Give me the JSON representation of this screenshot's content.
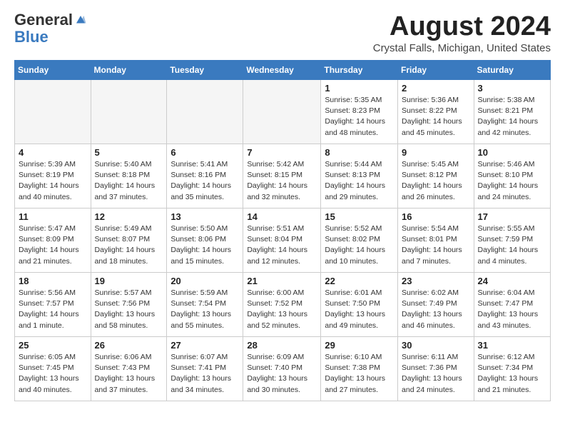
{
  "logo": {
    "general": "General",
    "blue": "Blue"
  },
  "header": {
    "month": "August 2024",
    "location": "Crystal Falls, Michigan, United States"
  },
  "days_of_week": [
    "Sunday",
    "Monday",
    "Tuesday",
    "Wednesday",
    "Thursday",
    "Friday",
    "Saturday"
  ],
  "weeks": [
    [
      {
        "day": "",
        "info": ""
      },
      {
        "day": "",
        "info": ""
      },
      {
        "day": "",
        "info": ""
      },
      {
        "day": "",
        "info": ""
      },
      {
        "day": "1",
        "info": "Sunrise: 5:35 AM\nSunset: 8:23 PM\nDaylight: 14 hours\nand 48 minutes."
      },
      {
        "day": "2",
        "info": "Sunrise: 5:36 AM\nSunset: 8:22 PM\nDaylight: 14 hours\nand 45 minutes."
      },
      {
        "day": "3",
        "info": "Sunrise: 5:38 AM\nSunset: 8:21 PM\nDaylight: 14 hours\nand 42 minutes."
      }
    ],
    [
      {
        "day": "4",
        "info": "Sunrise: 5:39 AM\nSunset: 8:19 PM\nDaylight: 14 hours\nand 40 minutes."
      },
      {
        "day": "5",
        "info": "Sunrise: 5:40 AM\nSunset: 8:18 PM\nDaylight: 14 hours\nand 37 minutes."
      },
      {
        "day": "6",
        "info": "Sunrise: 5:41 AM\nSunset: 8:16 PM\nDaylight: 14 hours\nand 35 minutes."
      },
      {
        "day": "7",
        "info": "Sunrise: 5:42 AM\nSunset: 8:15 PM\nDaylight: 14 hours\nand 32 minutes."
      },
      {
        "day": "8",
        "info": "Sunrise: 5:44 AM\nSunset: 8:13 PM\nDaylight: 14 hours\nand 29 minutes."
      },
      {
        "day": "9",
        "info": "Sunrise: 5:45 AM\nSunset: 8:12 PM\nDaylight: 14 hours\nand 26 minutes."
      },
      {
        "day": "10",
        "info": "Sunrise: 5:46 AM\nSunset: 8:10 PM\nDaylight: 14 hours\nand 24 minutes."
      }
    ],
    [
      {
        "day": "11",
        "info": "Sunrise: 5:47 AM\nSunset: 8:09 PM\nDaylight: 14 hours\nand 21 minutes."
      },
      {
        "day": "12",
        "info": "Sunrise: 5:49 AM\nSunset: 8:07 PM\nDaylight: 14 hours\nand 18 minutes."
      },
      {
        "day": "13",
        "info": "Sunrise: 5:50 AM\nSunset: 8:06 PM\nDaylight: 14 hours\nand 15 minutes."
      },
      {
        "day": "14",
        "info": "Sunrise: 5:51 AM\nSunset: 8:04 PM\nDaylight: 14 hours\nand 12 minutes."
      },
      {
        "day": "15",
        "info": "Sunrise: 5:52 AM\nSunset: 8:02 PM\nDaylight: 14 hours\nand 10 minutes."
      },
      {
        "day": "16",
        "info": "Sunrise: 5:54 AM\nSunset: 8:01 PM\nDaylight: 14 hours\nand 7 minutes."
      },
      {
        "day": "17",
        "info": "Sunrise: 5:55 AM\nSunset: 7:59 PM\nDaylight: 14 hours\nand 4 minutes."
      }
    ],
    [
      {
        "day": "18",
        "info": "Sunrise: 5:56 AM\nSunset: 7:57 PM\nDaylight: 14 hours\nand 1 minute."
      },
      {
        "day": "19",
        "info": "Sunrise: 5:57 AM\nSunset: 7:56 PM\nDaylight: 13 hours\nand 58 minutes."
      },
      {
        "day": "20",
        "info": "Sunrise: 5:59 AM\nSunset: 7:54 PM\nDaylight: 13 hours\nand 55 minutes."
      },
      {
        "day": "21",
        "info": "Sunrise: 6:00 AM\nSunset: 7:52 PM\nDaylight: 13 hours\nand 52 minutes."
      },
      {
        "day": "22",
        "info": "Sunrise: 6:01 AM\nSunset: 7:50 PM\nDaylight: 13 hours\nand 49 minutes."
      },
      {
        "day": "23",
        "info": "Sunrise: 6:02 AM\nSunset: 7:49 PM\nDaylight: 13 hours\nand 46 minutes."
      },
      {
        "day": "24",
        "info": "Sunrise: 6:04 AM\nSunset: 7:47 PM\nDaylight: 13 hours\nand 43 minutes."
      }
    ],
    [
      {
        "day": "25",
        "info": "Sunrise: 6:05 AM\nSunset: 7:45 PM\nDaylight: 13 hours\nand 40 minutes."
      },
      {
        "day": "26",
        "info": "Sunrise: 6:06 AM\nSunset: 7:43 PM\nDaylight: 13 hours\nand 37 minutes."
      },
      {
        "day": "27",
        "info": "Sunrise: 6:07 AM\nSunset: 7:41 PM\nDaylight: 13 hours\nand 34 minutes."
      },
      {
        "day": "28",
        "info": "Sunrise: 6:09 AM\nSunset: 7:40 PM\nDaylight: 13 hours\nand 30 minutes."
      },
      {
        "day": "29",
        "info": "Sunrise: 6:10 AM\nSunset: 7:38 PM\nDaylight: 13 hours\nand 27 minutes."
      },
      {
        "day": "30",
        "info": "Sunrise: 6:11 AM\nSunset: 7:36 PM\nDaylight: 13 hours\nand 24 minutes."
      },
      {
        "day": "31",
        "info": "Sunrise: 6:12 AM\nSunset: 7:34 PM\nDaylight: 13 hours\nand 21 minutes."
      }
    ]
  ]
}
